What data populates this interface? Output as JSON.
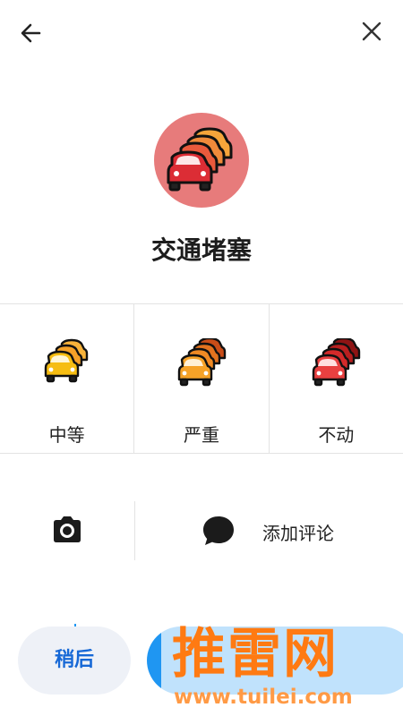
{
  "header": {
    "back_icon": "arrow-left-icon",
    "close_icon": "close-icon"
  },
  "hero": {
    "icon": "traffic-jam-icon",
    "circle_color": "#e77b7b",
    "title": "交通堵塞"
  },
  "severity_options": [
    {
      "label": "中等",
      "icon": "traffic-moderate-icon",
      "color": "#f5b50a"
    },
    {
      "label": "严重",
      "icon": "traffic-heavy-icon",
      "color": "#f28a18"
    },
    {
      "label": "不动",
      "icon": "traffic-standstill-icon",
      "color": "#e23a3a"
    }
  ],
  "actions": {
    "camera_icon": "camera-icon",
    "comment_icon": "comment-bubble-icon",
    "comment_label": "添加评论"
  },
  "footer": {
    "later_label": "稍后",
    "send_color": "#1f96f2"
  },
  "watermark": {
    "main": "推雷网",
    "url": "www.tuilei.com"
  }
}
